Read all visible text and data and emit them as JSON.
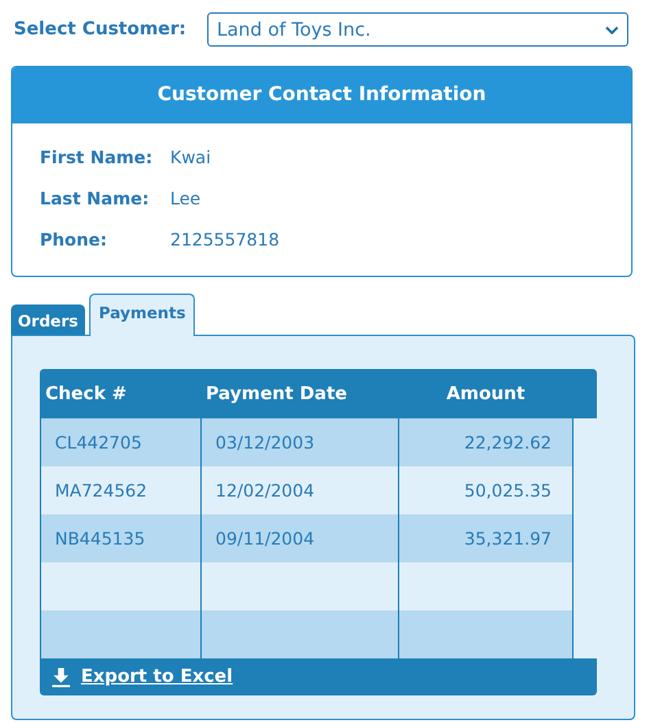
{
  "customer_select": {
    "label": "Select Customer:",
    "value": "Land of Toys Inc."
  },
  "contact_card": {
    "title": "Customer Contact Information",
    "fields": [
      {
        "label": "First Name:",
        "value": "Kwai"
      },
      {
        "label": "Last Name:",
        "value": "Lee"
      },
      {
        "label": "Phone:",
        "value": "2125557818"
      }
    ]
  },
  "tabs": [
    {
      "label": "Orders",
      "selected": false
    },
    {
      "label": "Payments",
      "selected": true
    }
  ],
  "table": {
    "columns": [
      "Check #",
      "Payment Date",
      "Amount"
    ],
    "rows": [
      [
        "CL442705",
        "03/12/2003",
        "22,292.62"
      ],
      [
        "MA724562",
        "12/02/2004",
        "50,025.35"
      ],
      [
        "NB445135",
        "09/11/2004",
        "35,321.97"
      ]
    ]
  },
  "export_link": "Export to Excel"
}
